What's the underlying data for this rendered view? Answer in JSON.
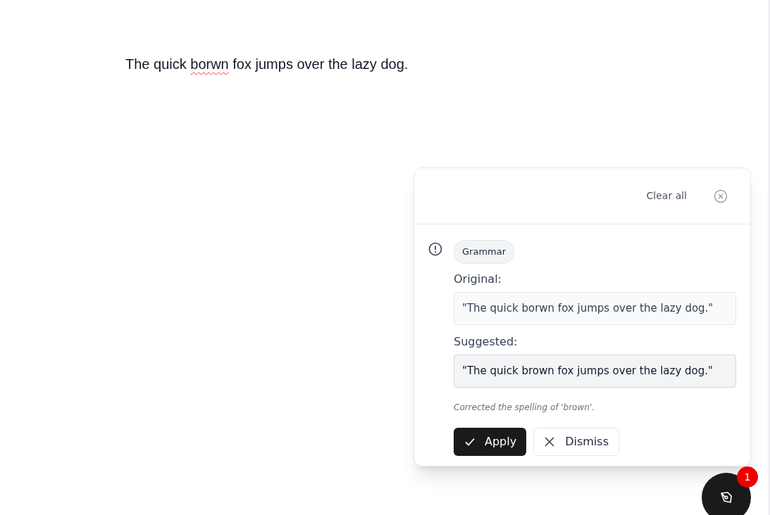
{
  "editor": {
    "segments": [
      {
        "text": "The quick ",
        "misspelled": false
      },
      {
        "text": "borwn",
        "misspelled": true
      },
      {
        "text": " fox jumps over the lazy dog.",
        "misspelled": false
      }
    ]
  },
  "panel": {
    "clear_label": "Clear all",
    "suggestion": {
      "category": "Grammar",
      "original_label": "Original:",
      "original": "\"The quick borwn fox jumps over the lazy dog.\"",
      "suggested_label": "Suggested:",
      "suggested": "\"The quick brown fox jumps over the lazy dog.\"",
      "explanation": "Corrected the spelling of 'brown'.",
      "apply_label": "Apply",
      "dismiss_label": "Dismiss"
    }
  },
  "fab": {
    "badge": "1"
  }
}
